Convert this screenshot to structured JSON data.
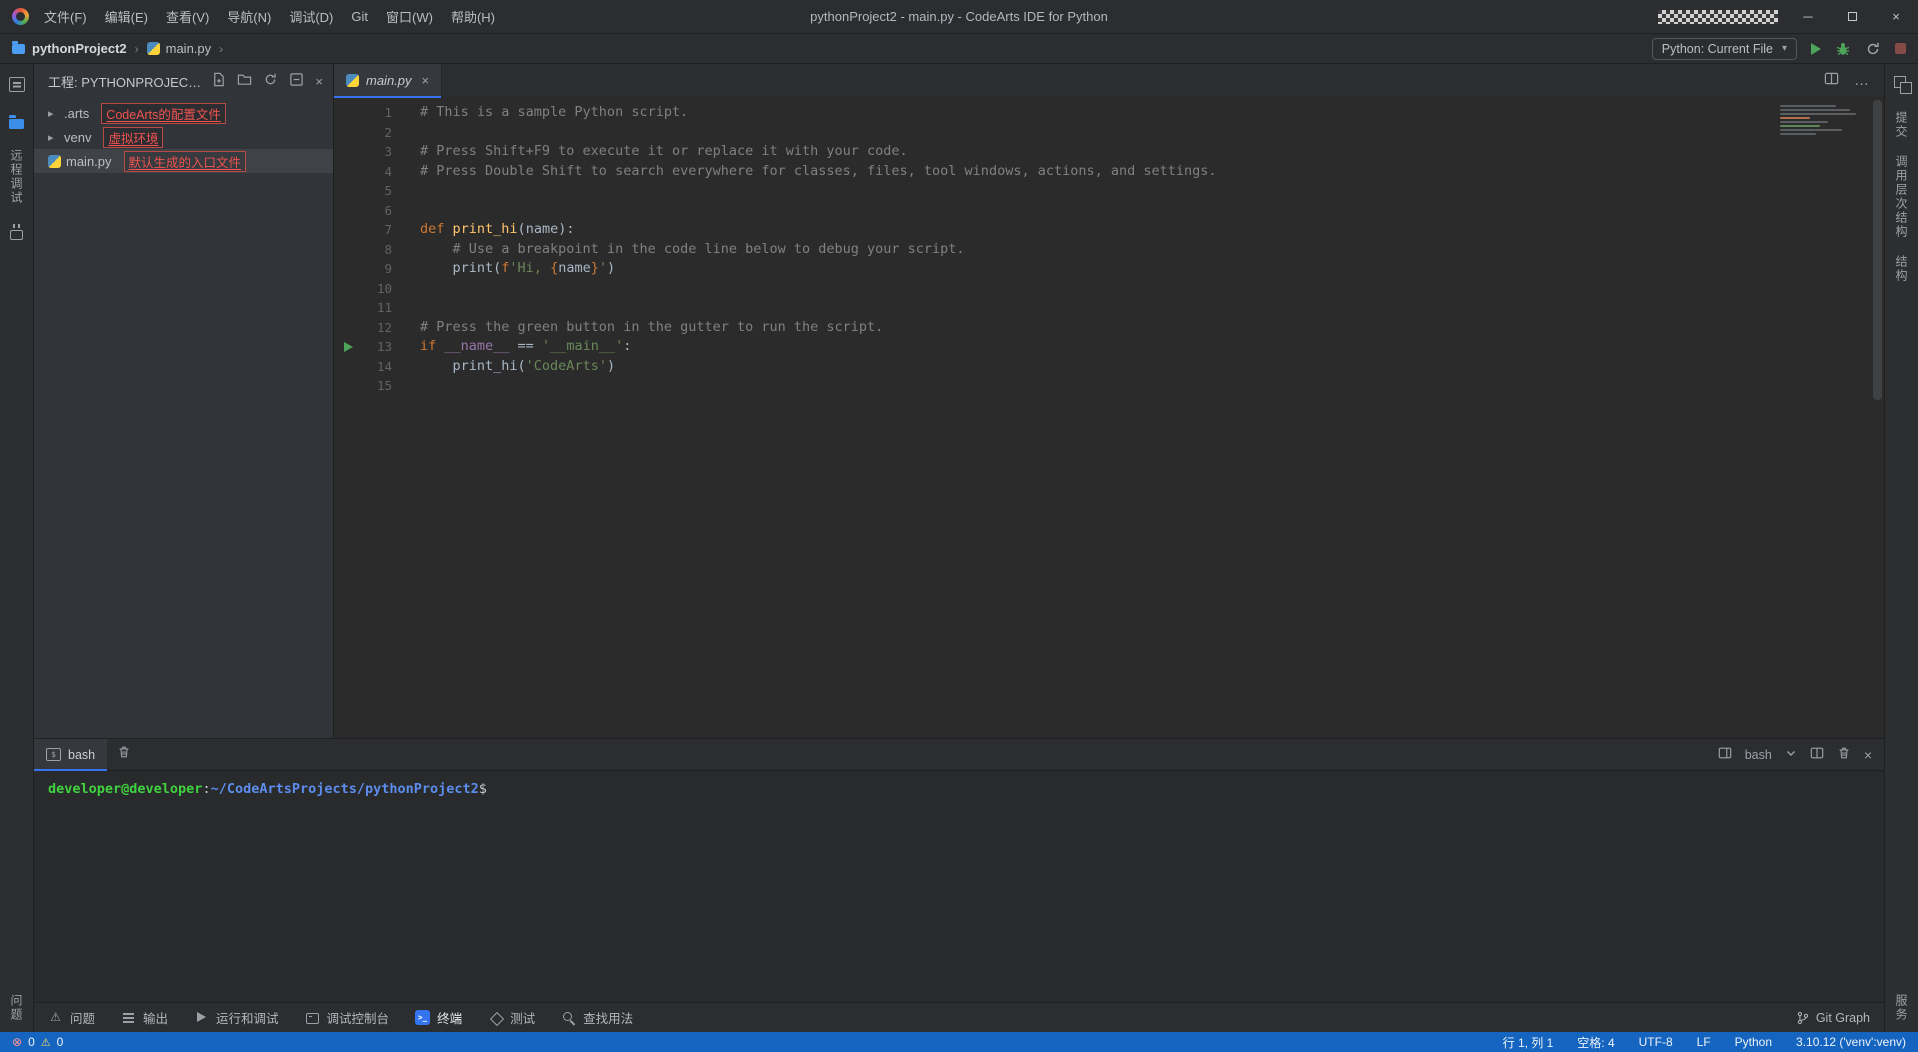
{
  "titlebar": {
    "title": "pythonProject2 - main.py - CodeArts IDE for Python",
    "menus": [
      "文件(F)",
      "编辑(E)",
      "查看(V)",
      "导航(N)",
      "调试(D)",
      "Git",
      "窗口(W)",
      "帮助(H)"
    ]
  },
  "toolbar": {
    "breadcrumbs": [
      "pythonProject2",
      "main.py"
    ],
    "run_config": "Python: Current File"
  },
  "activity_left": {
    "top": [
      {
        "kind": "icon",
        "icon": "project-tool",
        "name": "project-tool-icon"
      },
      {
        "kind": "icon",
        "icon": "explorer",
        "name": "explorer-icon"
      },
      {
        "kind": "label",
        "label": "远程调试",
        "name": "tool-remote-debug"
      },
      {
        "kind": "icon",
        "icon": "plugin",
        "name": "plugin-icon"
      }
    ],
    "bottom": [
      {
        "kind": "label",
        "label": "问题",
        "name": "tool-problems"
      }
    ]
  },
  "activity_right": {
    "top": [
      {
        "kind": "icon",
        "icon": "layers",
        "name": "layers-icon"
      },
      {
        "kind": "label",
        "label": "提交",
        "name": "tool-commit"
      },
      {
        "kind": "label",
        "label": "调用层次结构",
        "name": "tool-call-hierarchy"
      },
      {
        "kind": "label",
        "label": "结构",
        "name": "tool-structure"
      }
    ],
    "bottom": [
      {
        "kind": "label",
        "label": "服务",
        "name": "tool-services"
      }
    ]
  },
  "project": {
    "header": "工程: PYTHONPROJEC…",
    "items": [
      {
        "id": "arts",
        "label": ".arts",
        "annotation": "CodeArts的配置文件",
        "expandable": true,
        "selected": false
      },
      {
        "id": "venv",
        "label": "venv",
        "annotation": "虚拟环境",
        "expandable": true,
        "selected": false
      },
      {
        "id": "main-py",
        "label": "main.py",
        "annotation": "默认生成的入口文件",
        "expandable": false,
        "selected": true
      }
    ]
  },
  "editor": {
    "tab": "main.py",
    "lines": [
      {
        "n": "1",
        "tokens": [
          [
            "comment",
            "# This is a sample Python script."
          ]
        ]
      },
      {
        "n": "2",
        "tokens": []
      },
      {
        "n": "3",
        "tokens": [
          [
            "comment",
            "# Press Shift+F9 to execute it or replace it with your code."
          ]
        ]
      },
      {
        "n": "4",
        "tokens": [
          [
            "comment",
            "# Press Double Shift to search everywhere for classes, files, tool windows, actions, and settings."
          ]
        ]
      },
      {
        "n": "5",
        "tokens": []
      },
      {
        "n": "6",
        "tokens": []
      },
      {
        "n": "7",
        "tokens": [
          [
            "kw",
            "def "
          ],
          [
            "func",
            "print_hi"
          ],
          [
            "plain",
            "("
          ],
          [
            "param",
            "name"
          ],
          [
            "plain",
            "):"
          ]
        ]
      },
      {
        "n": "8",
        "tokens": [
          [
            "plain",
            "    "
          ],
          [
            "comment",
            "# Use a breakpoint in the code line below to debug your script."
          ]
        ]
      },
      {
        "n": "9",
        "tokens": [
          [
            "plain",
            "    print("
          ],
          [
            "kw",
            "f"
          ],
          [
            "str",
            "'Hi, "
          ],
          [
            "brace",
            "{"
          ],
          [
            "plain",
            "name"
          ],
          [
            "brace",
            "}"
          ],
          [
            "str",
            "'"
          ],
          [
            "plain",
            ")"
          ]
        ]
      },
      {
        "n": "10",
        "tokens": []
      },
      {
        "n": "11",
        "tokens": []
      },
      {
        "n": "12",
        "tokens": [
          [
            "comment",
            "# Press the green button in the gutter to run the script."
          ]
        ]
      },
      {
        "n": "13",
        "run": true,
        "tokens": [
          [
            "kw",
            "if "
          ],
          [
            "dunder",
            "__name__"
          ],
          [
            "plain",
            " == "
          ],
          [
            "str",
            "'__main__'"
          ],
          [
            "plain",
            ":"
          ]
        ]
      },
      {
        "n": "14",
        "tokens": [
          [
            "plain",
            "    print_hi("
          ],
          [
            "str",
            "'CodeArts'"
          ],
          [
            "plain",
            ")"
          ]
        ]
      },
      {
        "n": "15",
        "tokens": []
      }
    ]
  },
  "terminal": {
    "tab": "bash",
    "profile": "bash",
    "prompt": {
      "user": "developer@developer",
      "colon": ":",
      "path": "~/CodeArtsProjects/pythonProject2",
      "dollar": "$"
    }
  },
  "bottom_tabs": {
    "items": [
      {
        "label": "问题",
        "icon": "warn",
        "active": false
      },
      {
        "label": "输出",
        "icon": "output",
        "active": false
      },
      {
        "label": "运行和调试",
        "icon": "run",
        "active": false
      },
      {
        "label": "调试控制台",
        "icon": "console",
        "active": false
      },
      {
        "label": "终端",
        "icon": "terminal",
        "active": true
      },
      {
        "label": "测试",
        "icon": "test",
        "active": false
      },
      {
        "label": "查找用法",
        "icon": "search",
        "active": false
      }
    ],
    "right_label": "Git Graph"
  },
  "statusbar": {
    "errors": "0",
    "warnings": "0",
    "segments": [
      "行 1, 列 1",
      "空格: 4",
      "UTF-8",
      "LF",
      "Python",
      "3.10.12 ('venv':venv)"
    ]
  },
  "colors": {
    "accent_blue": "#3574f0",
    "status_blue": "#1565c0",
    "run_green": "#4fa45b",
    "annotation_red": "#ef5350",
    "editor_bg": "#2b2b2b",
    "chrome_bg": "#2b2d30"
  }
}
